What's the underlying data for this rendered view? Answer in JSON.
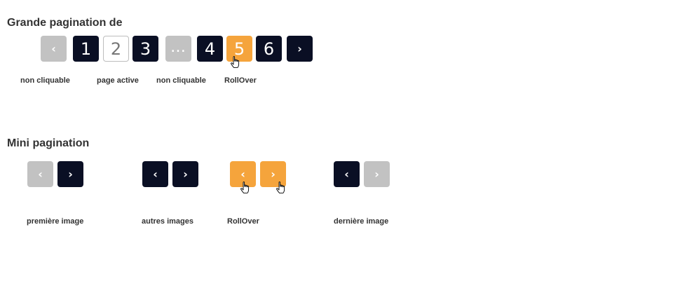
{
  "large_section": {
    "title": "Grande pagination de",
    "buttons": {
      "prev": "‹",
      "p1": "1",
      "p2": "2",
      "p3": "3",
      "ellipsis": "…",
      "p4": "4",
      "p5": "5",
      "p6": "6",
      "next": "›"
    },
    "captions": {
      "non_clickable_1": "non cliquable",
      "active_page": "page active",
      "non_clickable_2": "non cliquable",
      "rollover": "RollOver"
    }
  },
  "mini_section": {
    "title": "Mini pagination",
    "arrows": {
      "prev": "‹",
      "next": "›"
    },
    "captions": {
      "first_image": "première image",
      "other_images": "autres images",
      "rollover": "RollOver",
      "last_image": "dernière image"
    }
  },
  "colors": {
    "dark": "#0a0f24",
    "disabled": "#c2c2c2",
    "hover": "#f5a43c",
    "active_border": "#bdbdbd"
  },
  "icons": {
    "prev": "chevron-left-icon",
    "next": "chevron-right-icon",
    "cursor": "hand-pointer-icon"
  }
}
